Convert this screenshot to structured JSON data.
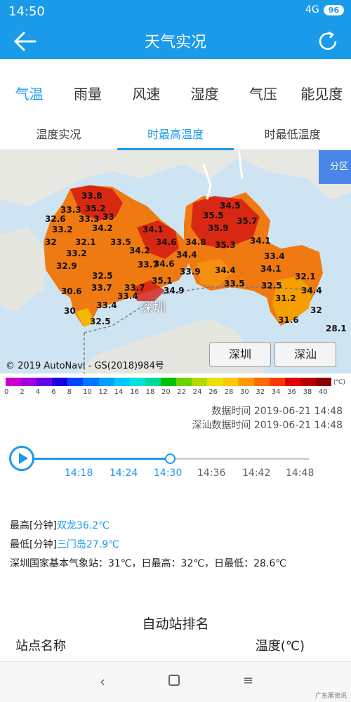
{
  "status": {
    "time": "14:50",
    "signal": "4G",
    "battery": "96"
  },
  "header": {
    "title": "天气实况"
  },
  "tabs": [
    "气温",
    "雨量",
    "风速",
    "湿度",
    "气压",
    "能见度"
  ],
  "subtabs": [
    "温度实况",
    "时最高温度",
    "时最低温度"
  ],
  "map": {
    "zone_button": "分区",
    "city_label": "深圳",
    "buttons": [
      "深圳",
      "深汕"
    ],
    "copyright": "© 2019 AutoNavi - GS(2018)984号",
    "labels": [
      "33.8",
      "35.2",
      "33.3",
      "33.3",
      "32.6",
      "33",
      "33.2",
      "34.2",
      "34.1",
      "32",
      "32.1",
      "33.2",
      "33.5",
      "34.2",
      "34.6",
      "32.9",
      "33.7",
      "34.4",
      "33.9",
      "34.6",
      "32.5",
      "35.1",
      "30.6",
      "33.7",
      "33.7",
      "33.4",
      "34.9",
      "30",
      "33.4",
      "32.5",
      "34.5",
      "35.5",
      "35.7",
      "35.9",
      "34.8",
      "35.3",
      "34.1",
      "33.4",
      "34.1",
      "34.4",
      "33.5",
      "32.5",
      "32.1",
      "34.4",
      "31.2",
      "32",
      "31.6",
      "28.1"
    ]
  },
  "legend": {
    "colors": [
      "#cc00cc",
      "#a000e0",
      "#6a00e6",
      "#1900e0",
      "#0044ff",
      "#0077ff",
      "#00a0ff",
      "#00c8ff",
      "#00e0e0",
      "#00d79b",
      "#00c000",
      "#6bd200",
      "#b4d800",
      "#f0e000",
      "#ffc800",
      "#ff9a00",
      "#ff6a00",
      "#ff3a00",
      "#e00000",
      "#b80000",
      "#8c0000"
    ],
    "ticks": [
      "0",
      "2",
      "4",
      "6",
      "8",
      "10",
      "12",
      "14",
      "16",
      "18",
      "20",
      "22",
      "24",
      "26",
      "28",
      "30",
      "32",
      "34",
      "36",
      "38",
      "40"
    ],
    "unit": "(℃)"
  },
  "data_time": "数据时间 2019-06-21 14:48",
  "shenshan_time": "深汕数据时间 2019-06-21 14:48",
  "timeline": {
    "ticks": [
      "14:18",
      "14:24",
      "14:30",
      "14:36",
      "14:42",
      "14:48"
    ]
  },
  "stats": {
    "max_prefix": "最高[分钟]",
    "max_value": "双龙36.2℃",
    "min_prefix": "最低[分钟]",
    "min_value": "三门岛27.9℃",
    "national": "深圳国家基本气象站：31℃，日最高：32℃，日最低：28.6℃"
  },
  "ranking": {
    "title": "自动站排名",
    "col_station": "站点名称",
    "col_temp": "温度(℃)"
  },
  "watermark": "广东黑资讯"
}
